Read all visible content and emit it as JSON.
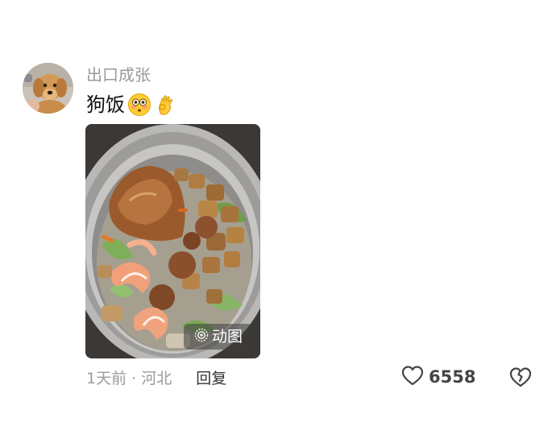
{
  "comment": {
    "username": "出口成张",
    "text": "狗饭",
    "emojis": [
      "flushed-face-emoji",
      "ok-hand-emoji"
    ],
    "image_badge": "动图",
    "time_location": "1天前 · 河北",
    "reply_label": "回复",
    "like_count": "6558"
  },
  "icons": {
    "like": "heart-outline-icon",
    "dislike": "broken-heart-icon",
    "gif": "live-photo-icon"
  },
  "colors": {
    "username": "#9a9a9a",
    "text": "#111111",
    "meta": "#9a9a9a",
    "reply": "#333333"
  }
}
